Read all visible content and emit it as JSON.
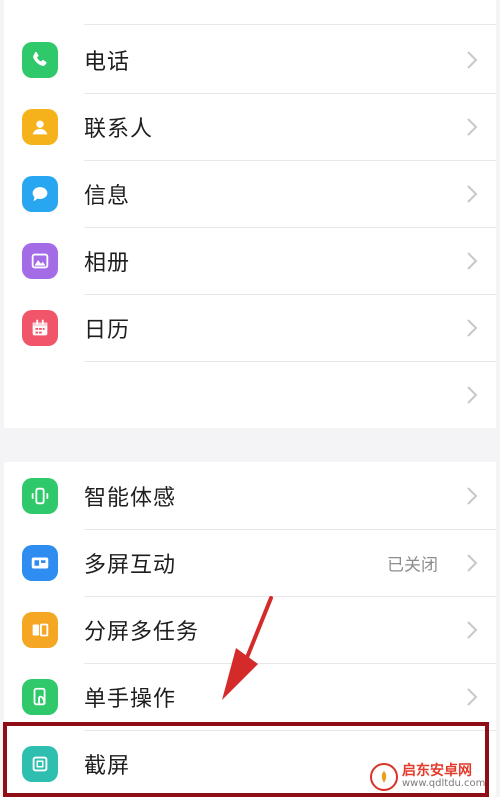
{
  "top_group": {
    "items": [
      {
        "label": "电话",
        "icon": "phone-icon",
        "color": "#2fc86a"
      },
      {
        "label": "联系人",
        "icon": "contact-icon",
        "color": "#f5b21a"
      },
      {
        "label": "信息",
        "icon": "message-icon",
        "color": "#29a6f0"
      },
      {
        "label": "相册",
        "icon": "album-icon",
        "color": "#a36be6"
      },
      {
        "label": "日历",
        "icon": "calendar-icon",
        "color": "#f0556a"
      },
      {
        "label": ""
      }
    ]
  },
  "bottom_group": {
    "items": [
      {
        "label": "智能体感",
        "icon": "motion-sense-icon",
        "color": "#2fc86a"
      },
      {
        "label": "多屏互动",
        "value": "已关闭",
        "icon": "multi-screen-icon",
        "color": "#2f8cf0"
      },
      {
        "label": "分屏多任务",
        "icon": "split-screen-icon",
        "color": "#f5a623"
      },
      {
        "label": "单手操作",
        "icon": "one-hand-icon",
        "color": "#2fc86a"
      },
      {
        "label": "截屏",
        "icon": "screenshot-icon",
        "color": "#2fbfb0"
      }
    ]
  },
  "watermark": {
    "name": "启东安卓网",
    "url": "www.qdltdu.com"
  },
  "colors": {
    "highlight": "#8f0d16",
    "arrow": "#d42a2a"
  }
}
